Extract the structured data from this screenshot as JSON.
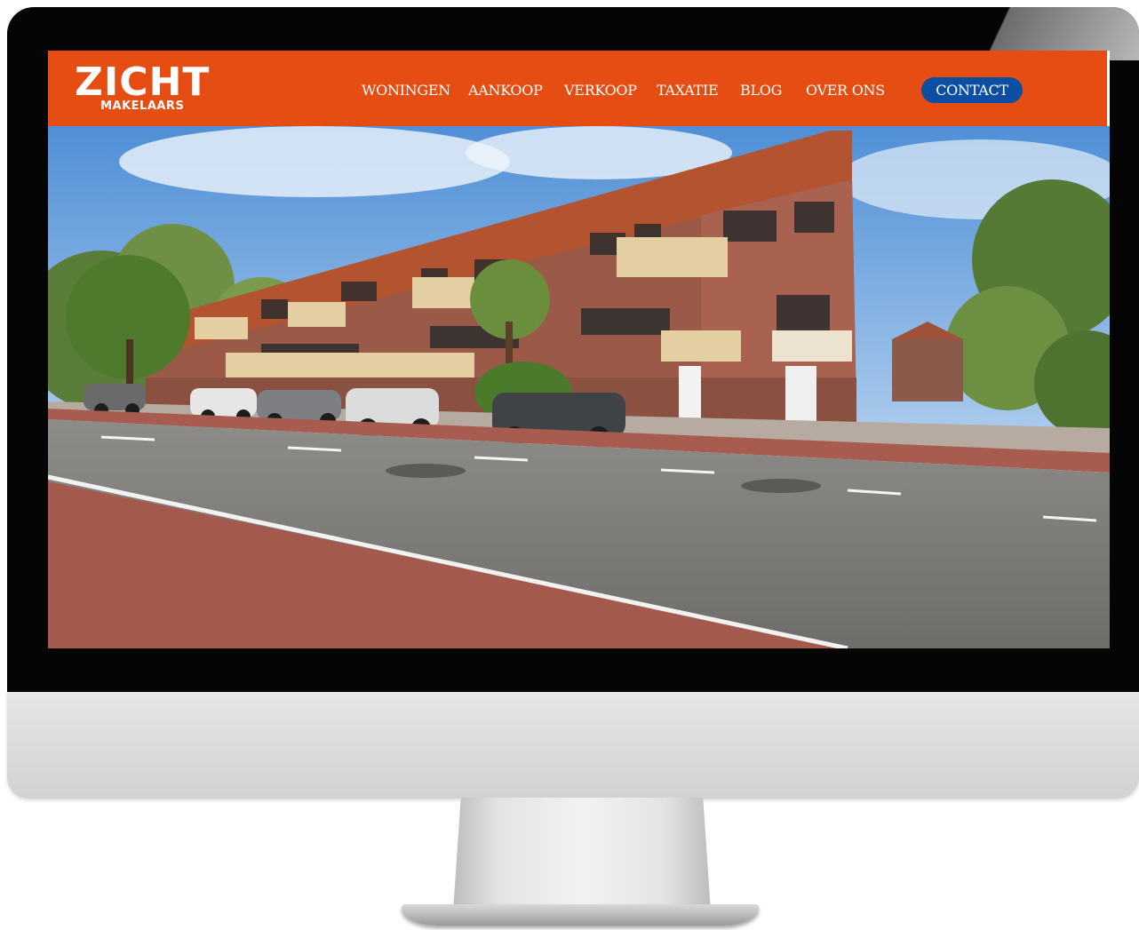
{
  "brand": {
    "name": "ZICHT",
    "tagline": "MAKELAARS"
  },
  "nav": {
    "items": [
      {
        "label": "WONINGEN"
      },
      {
        "label": "AANKOOP"
      },
      {
        "label": "VERKOOP"
      },
      {
        "label": "TAXATIE"
      },
      {
        "label": "BLOG"
      },
      {
        "label": "OVER ONS"
      }
    ],
    "contact_label": "CONTACT"
  },
  "colors": {
    "header_bg": "#e64d12",
    "contact_bg": "#0b4ea2",
    "nav_text": "#ffffff"
  },
  "hero": {
    "image_subject": "street-view photo of brick apartment building with parked cars"
  }
}
